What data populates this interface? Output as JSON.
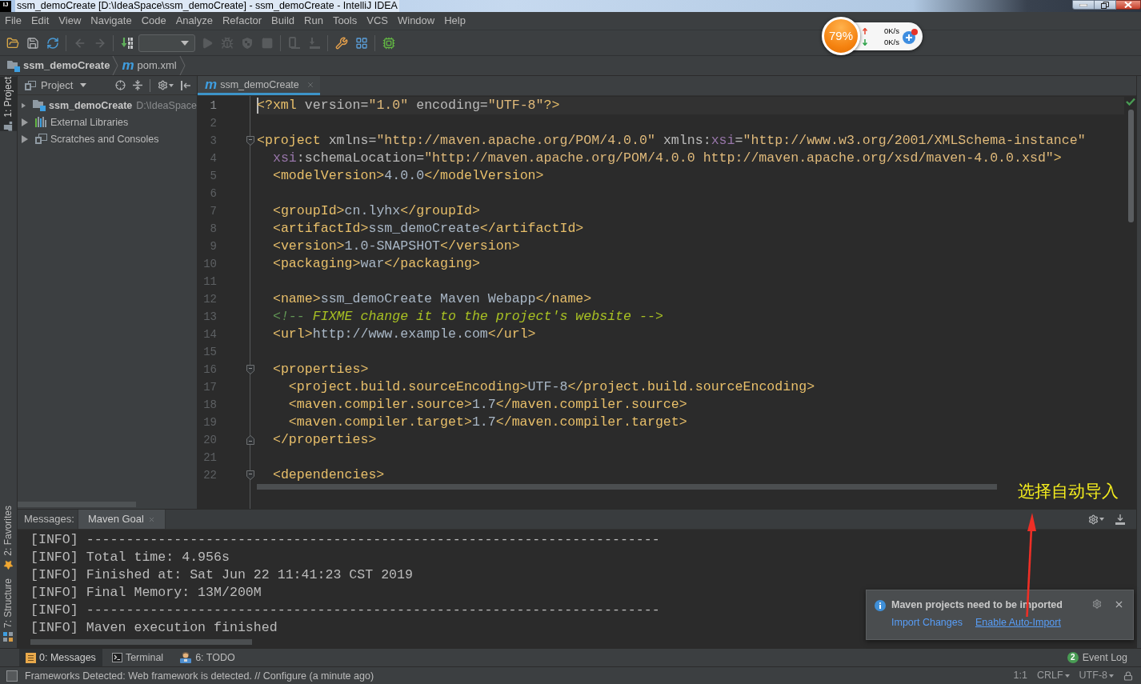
{
  "window": {
    "logo": "IJ",
    "title": "ssm_demoCreate [D:\\IdeaSpace\\ssm_demoCreate] - ssm_demoCreate - IntelliJ IDEA"
  },
  "menu": [
    "File",
    "Edit",
    "View",
    "Navigate",
    "Code",
    "Analyze",
    "Refactor",
    "Build",
    "Run",
    "Tools",
    "VCS",
    "Window",
    "Help"
  ],
  "toolbar": [
    {
      "kind": "open",
      "disabled": false
    },
    {
      "kind": "save",
      "disabled": false
    },
    {
      "kind": "sync",
      "disabled": false
    },
    {
      "kind": "separator"
    },
    {
      "kind": "back",
      "disabled": true
    },
    {
      "kind": "forward",
      "disabled": true
    },
    {
      "kind": "separator"
    },
    {
      "kind": "build",
      "disabled": false
    },
    {
      "kind": "run_config"
    },
    {
      "kind": "run",
      "disabled": true
    },
    {
      "kind": "debug",
      "disabled": true
    },
    {
      "kind": "coverage",
      "disabled": true
    },
    {
      "kind": "stop",
      "disabled": true
    },
    {
      "kind": "separator"
    },
    {
      "kind": "attach",
      "disabled": true
    },
    {
      "kind": "deploy",
      "disabled": true
    },
    {
      "kind": "separator"
    },
    {
      "kind": "structure",
      "disabled": false
    },
    {
      "kind": "modules",
      "disabled": false
    },
    {
      "kind": "separator"
    },
    {
      "kind": "sdk",
      "disabled": false
    }
  ],
  "speed_widget": {
    "percent": "79%",
    "upload": "0K/s",
    "download": "0K/s"
  },
  "breadcrumbs": [
    {
      "label": "ssm_demoCreate",
      "kind": "module"
    },
    {
      "label": "pom.xml",
      "kind": "maven",
      "icon": "m"
    }
  ],
  "left_strip": [
    {
      "label": "1: Project",
      "kind": "project",
      "selected": true
    },
    {
      "label": "2: Favorites",
      "kind": "favorites",
      "selected": false
    },
    {
      "label": "7: Structure",
      "kind": "structure",
      "selected": false
    }
  ],
  "project_panel": {
    "title": "Project",
    "tree": [
      {
        "label": "ssm_demoCreate",
        "path": "D:\\IdeaSpace",
        "kind": "module",
        "expanded": false
      },
      {
        "label": "External Libraries",
        "kind": "libraries",
        "expanded": false
      },
      {
        "label": "Scratches and Consoles",
        "kind": "scratches",
        "expanded": false
      }
    ]
  },
  "editor": {
    "tabs": [
      {
        "icon": "m",
        "label": "ssm_demoCreate",
        "selected": true
      }
    ],
    "lines": [
      {
        "number": "1",
        "kind": "plain",
        "current": true,
        "tokens": [
          {
            "text": "<?xml",
            "kind": "tag"
          },
          {
            "text": " version=",
            "kind": "attr"
          },
          {
            "text": "\"1.0\"",
            "kind": "value"
          },
          {
            "text": " encoding=",
            "kind": "attr"
          },
          {
            "text": "\"UTF-8\"",
            "kind": "value"
          },
          {
            "text": "?>",
            "kind": "tag"
          }
        ]
      },
      {
        "number": "2",
        "kind": "plain",
        "current": false
      },
      {
        "number": "3",
        "kind": "foldstart",
        "current": false,
        "tokens": [
          {
            "text": "<project",
            "kind": "tag"
          },
          {
            "text": " xmlns=",
            "kind": "attr"
          },
          {
            "text": "\"http://maven.apache.org/POM/4.0.0\"",
            "kind": "value"
          },
          {
            "text": " xmlns:",
            "kind": "attr"
          },
          {
            "text": "xsi",
            "kind": "ns"
          },
          {
            "text": "=",
            "kind": "attr"
          },
          {
            "text": "\"http://www.w3.org/2001/XMLSchema-instance\"",
            "kind": "value"
          }
        ]
      },
      {
        "number": "4",
        "kind": "plain",
        "current": false,
        "tokens": [
          {
            "text": "  xsi",
            "kind": "ns"
          },
          {
            "text": ":schemaLocation=",
            "kind": "attr"
          },
          {
            "text": "\"http://maven.apache.org/POM/4.0.0 http://maven.apache.org/xsd/maven-4.0.0.xsd\"",
            "kind": "value"
          },
          {
            "text": ">",
            "kind": "tag"
          }
        ]
      },
      {
        "number": "5",
        "kind": "plain",
        "current": false,
        "tokens": [
          {
            "text": "  <modelVersion>",
            "kind": "tag"
          },
          {
            "text": "4.0.0",
            "kind": "text"
          },
          {
            "text": "</modelVersion>",
            "kind": "tag"
          }
        ]
      },
      {
        "number": "6",
        "kind": "plain",
        "current": false
      },
      {
        "number": "7",
        "kind": "plain",
        "current": false,
        "tokens": [
          {
            "text": "  <groupId>",
            "kind": "tag"
          },
          {
            "text": "cn.lyhx",
            "kind": "text"
          },
          {
            "text": "</groupId>",
            "kind": "tag"
          }
        ]
      },
      {
        "number": "8",
        "kind": "plain",
        "current": false,
        "tokens": [
          {
            "text": "  <artifactId>",
            "kind": "tag"
          },
          {
            "text": "ssm_demoCreate",
            "kind": "text"
          },
          {
            "text": "</artifactId>",
            "kind": "tag"
          }
        ]
      },
      {
        "number": "9",
        "kind": "plain",
        "current": false,
        "tokens": [
          {
            "text": "  <version>",
            "kind": "tag"
          },
          {
            "text": "1.0-SNAPSHOT",
            "kind": "text"
          },
          {
            "text": "</version>",
            "kind": "tag"
          }
        ]
      },
      {
        "number": "10",
        "kind": "plain",
        "current": false,
        "tokens": [
          {
            "text": "  <packaging>",
            "kind": "tag"
          },
          {
            "text": "war",
            "kind": "text"
          },
          {
            "text": "</packaging>",
            "kind": "tag"
          }
        ]
      },
      {
        "number": "11",
        "kind": "plain",
        "current": false
      },
      {
        "number": "12",
        "kind": "plain",
        "current": false,
        "tokens": [
          {
            "text": "  <name>",
            "kind": "tag"
          },
          {
            "text": "ssm_demoCreate Maven Webapp",
            "kind": "text"
          },
          {
            "text": "</name>",
            "kind": "tag"
          }
        ]
      },
      {
        "number": "13",
        "kind": "plain",
        "current": false,
        "tokens": [
          {
            "text": "  <!-- ",
            "kind": "comment"
          },
          {
            "text": "FIXME change it to the project's website -->",
            "kind": "todo"
          }
        ]
      },
      {
        "number": "14",
        "kind": "plain",
        "current": false,
        "tokens": [
          {
            "text": "  <url>",
            "kind": "tag"
          },
          {
            "text": "http://www.example.com",
            "kind": "text"
          },
          {
            "text": "</url>",
            "kind": "tag"
          }
        ]
      },
      {
        "number": "15",
        "kind": "plain",
        "current": false
      },
      {
        "number": "16",
        "kind": "foldstart",
        "current": false,
        "tokens": [
          {
            "text": "  <properties>",
            "kind": "tag"
          }
        ]
      },
      {
        "number": "17",
        "kind": "plain",
        "current": false,
        "tokens": [
          {
            "text": "    <project.build.sourceEncoding>",
            "kind": "tag"
          },
          {
            "text": "UTF-8",
            "kind": "text"
          },
          {
            "text": "</project.build.sourceEncoding>",
            "kind": "tag"
          }
        ]
      },
      {
        "number": "18",
        "kind": "plain",
        "current": false,
        "tokens": [
          {
            "text": "    <maven.compiler.source>",
            "kind": "tag"
          },
          {
            "text": "1.7",
            "kind": "text"
          },
          {
            "text": "</maven.compiler.source>",
            "kind": "tag"
          }
        ]
      },
      {
        "number": "19",
        "kind": "plain",
        "current": false,
        "tokens": [
          {
            "text": "    <maven.compiler.target>",
            "kind": "tag"
          },
          {
            "text": "1.7",
            "kind": "text"
          },
          {
            "text": "</maven.compiler.target>",
            "kind": "tag"
          }
        ]
      },
      {
        "number": "20",
        "kind": "foldend",
        "current": false,
        "tokens": [
          {
            "text": "  </properties>",
            "kind": "tag"
          }
        ]
      },
      {
        "number": "21",
        "kind": "plain",
        "current": false
      },
      {
        "number": "22",
        "kind": "foldstart",
        "current": false,
        "tokens": [
          {
            "text": "  <dependencies>",
            "kind": "tag"
          }
        ]
      }
    ]
  },
  "annotation": {
    "text": "选择自动导入"
  },
  "messages": {
    "label": "Messages:",
    "tabs": [
      {
        "label": "Maven Goal",
        "selected": true
      }
    ],
    "lines": [
      "[INFO] ------------------------------------------------------------------------",
      "[INFO] Total time: 4.956s",
      "[INFO] Finished at: Sat Jun 22 11:41:23 CST 2019",
      "[INFO] Final Memory: 13M/200M",
      "[INFO] ------------------------------------------------------------------------",
      "[INFO] Maven execution finished"
    ]
  },
  "notification": {
    "title": "Maven projects need to be imported",
    "links": [
      {
        "label": "Import Changes",
        "hovered": false
      },
      {
        "label": "Enable Auto-Import",
        "hovered": true
      }
    ]
  },
  "bottom_tabs": [
    {
      "label": "0: Messages",
      "kind": "messages",
      "selected": true
    },
    {
      "label": "Terminal",
      "kind": "terminal",
      "selected": false
    },
    {
      "label": "6: TODO",
      "kind": "todo",
      "selected": false
    }
  ],
  "event_log": {
    "count": "2",
    "label": "Event Log"
  },
  "status_bar": {
    "message": "Frameworks Detected: Web framework is detected. // Configure (a minute ago)",
    "position": "1:1",
    "line_separator": "CRLF",
    "encoding": "UTF-8"
  }
}
